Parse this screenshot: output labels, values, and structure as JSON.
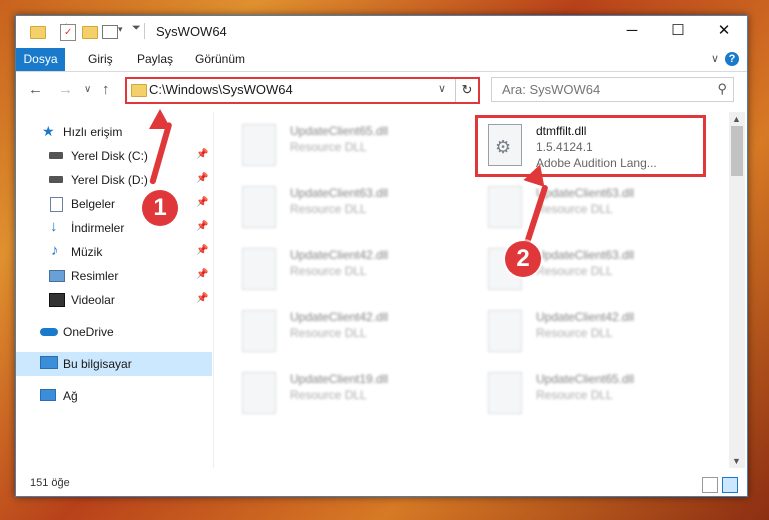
{
  "window": {
    "title": "SysWOW64"
  },
  "ribbon": {
    "tabs": [
      "Dosya",
      "Giriş",
      "Paylaş",
      "Görünüm"
    ]
  },
  "address": {
    "path": "C:\\Windows\\SysWOW64"
  },
  "search": {
    "placeholder": "Ara: SysWOW64"
  },
  "sidebar": {
    "items": [
      {
        "label": "Hızlı erişim",
        "icon": "star-icon"
      },
      {
        "label": "Yerel Disk (C:)",
        "icon": "drive-icon",
        "pinned": true
      },
      {
        "label": "Yerel Disk (D:)",
        "icon": "drive-icon",
        "pinned": true
      },
      {
        "label": "Belgeler",
        "icon": "documents-icon",
        "pinned": true
      },
      {
        "label": "İndirmeler",
        "icon": "download-icon",
        "pinned": true
      },
      {
        "label": "Müzik",
        "icon": "music-icon",
        "pinned": true
      },
      {
        "label": "Resimler",
        "icon": "pictures-icon",
        "pinned": true
      },
      {
        "label": "Videolar",
        "icon": "videos-icon",
        "pinned": true
      },
      {
        "label": "OneDrive",
        "icon": "cloud-icon"
      },
      {
        "label": "Bu bilgisayar",
        "icon": "computer-icon",
        "selected": true
      },
      {
        "label": "Ağ",
        "icon": "network-icon"
      }
    ]
  },
  "files": [
    {
      "name": "UpdateClient65.dll",
      "type": "Resource DLL",
      "blurred": true
    },
    {
      "name": "dtmffilt.dll",
      "version": "1.5.4124.1",
      "desc": "Adobe Audition Lang...",
      "blurred": false
    },
    {
      "name": "UpdateClient63.dll",
      "type": "Resource DLL",
      "blurred": true
    },
    {
      "name": "UpdateClient63.dll",
      "type": "Resource DLL",
      "blurred": true
    },
    {
      "name": "UpdateClient42.dll",
      "type": "Resource DLL",
      "blurred": true
    },
    {
      "name": "UpdateClient63.dll",
      "type": "Resource DLL",
      "blurred": true
    },
    {
      "name": "UpdateClient42.dll",
      "type": "Resource DLL",
      "blurred": true
    },
    {
      "name": "UpdateClient42.dll",
      "type": "Resource DLL",
      "blurred": true
    },
    {
      "name": "UpdateClient19.dll",
      "type": "Resource DLL",
      "blurred": true
    },
    {
      "name": "UpdateClient65.dll",
      "type": "Resource DLL",
      "blurred": true
    }
  ],
  "status": {
    "count": "151 öğe"
  },
  "markers": {
    "one": "1",
    "two": "2"
  },
  "colors": {
    "accent": "#1979ca",
    "annotation": "#e0373a",
    "selected": "#cce8ff"
  }
}
